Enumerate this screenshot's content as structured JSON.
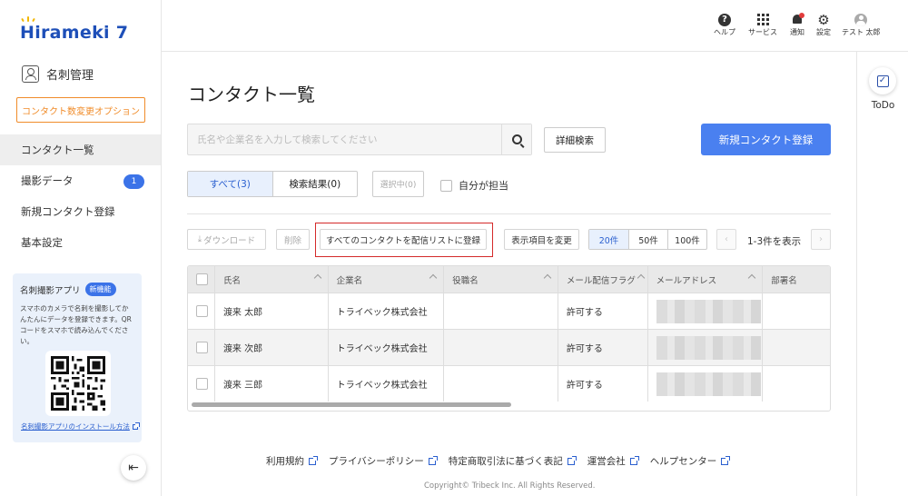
{
  "logo": {
    "text": "Hirameki 7"
  },
  "sidebar": {
    "section_title": "名刺管理",
    "option_button": "コンタクト数変更オプション",
    "items": [
      {
        "label": "コンタクト一覧",
        "active": true
      },
      {
        "label": "撮影データ",
        "badge": "1"
      },
      {
        "label": "新規コンタクト登録"
      },
      {
        "label": "基本設定"
      }
    ],
    "promo": {
      "title": "名刺撮影アプリ",
      "badge": "新機能",
      "description": "スマホのカメラで名刺を撮影してかんたんにデータを登録できます。QRコードをスマホで読み込んでください。",
      "link": "名刺撮影アプリのインストール方法"
    }
  },
  "topbar": {
    "help": "ヘルプ",
    "services": "サービス",
    "notifications": "通知",
    "settings": "設定",
    "user": "テスト 太郎"
  },
  "todo": {
    "label": "ToDo"
  },
  "main": {
    "title": "コンタクト一覧",
    "search_placeholder": "氏名や企業名を入力して検索してください",
    "advanced_search": "詳細検索",
    "new_contact": "新規コンタクト登録",
    "tabs": [
      {
        "label": "すべて(3)",
        "active": true
      },
      {
        "label": "検索結果(0)"
      }
    ],
    "selected": "選択中(0)",
    "mine": "自分が担当",
    "toolbar": {
      "download": "ダウンロード",
      "delete": "削除",
      "register_all": "すべてのコンタクトを配信リストに登録",
      "change_columns": "表示項目を変更"
    },
    "page_sizes": [
      {
        "label": "20件",
        "active": true
      },
      {
        "label": "50件"
      },
      {
        "label": "100件"
      }
    ],
    "range": "1-3件を表示",
    "table": {
      "headers": [
        "氏名",
        "企業名",
        "役職名",
        "メール配信フラグ",
        "メールアドレス",
        "部署名"
      ],
      "rows": [
        {
          "name": "渡来 太郎",
          "company": "トライベック株式会社",
          "title": "",
          "mail_flag": "許可する",
          "email": "",
          "dept": ""
        },
        {
          "name": "渡来 次郎",
          "company": "トライベック株式会社",
          "title": "",
          "mail_flag": "許可する",
          "email": "",
          "dept": ""
        },
        {
          "name": "渡来 三郎",
          "company": "トライベック株式会社",
          "title": "",
          "mail_flag": "許可する",
          "email": "",
          "dept": ""
        }
      ]
    }
  },
  "footer": {
    "links": [
      "利用規約",
      "プライバシーポリシー",
      "特定商取引法に基づく表記",
      "運営会社",
      "ヘルプセンター"
    ],
    "copyright": "Copyright© Tribeck Inc. All Rights Reserved."
  },
  "colors": {
    "primary": "#4a80f0",
    "accent_orange": "#f08c2a",
    "logo_blue": "#1e4fb8",
    "highlight_red": "#d42a2a"
  }
}
